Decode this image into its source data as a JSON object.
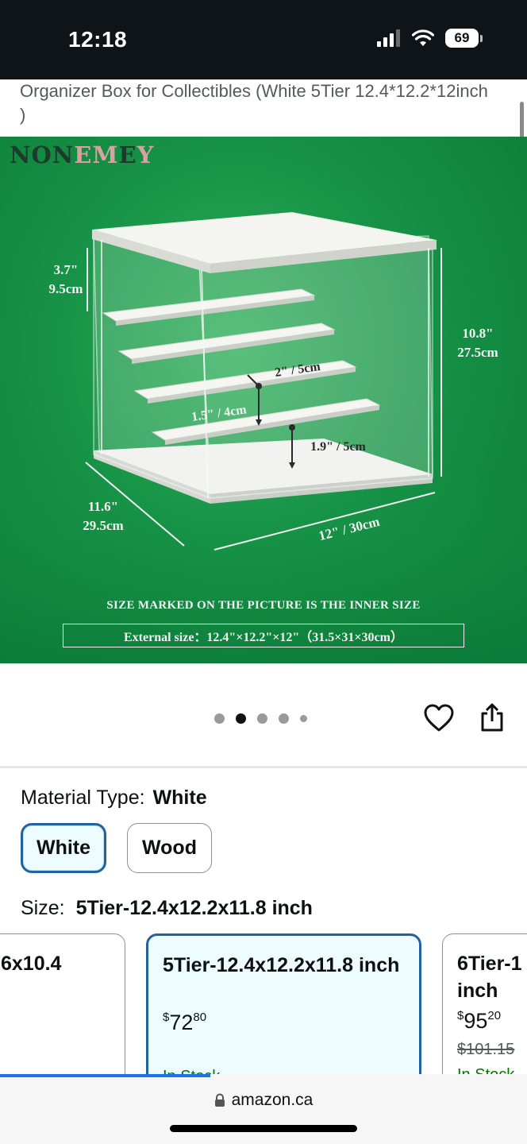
{
  "status": {
    "time": "12:18",
    "battery": "69"
  },
  "product": {
    "title": "Organizer Box for Collectibles (White 5Tier 12.4*12.2*12inch )"
  },
  "hero": {
    "brand_part1": "NON",
    "brand_part2": "EM",
    "brand_part3": "E",
    "brand_part4": "Y",
    "dim_top_a": "3.7\"",
    "dim_top_b": "9.5cm",
    "dim_right_a": "10.8\"",
    "dim_right_b": "27.5cm",
    "dim_step": "2\" / 5cm",
    "dim_depth_step": "1.5\" / 4cm",
    "dim_gap": "1.9\" / 5cm",
    "dim_left_a": "11.6\"",
    "dim_left_b": "29.5cm",
    "dim_bottom": "12\" / 30cm",
    "note_inner": "SIZE MARKED ON THE PICTURE IS THE INNER SIZE",
    "note_external": "External size：12.4\"×12.2\"×12\"（31.5×31×30cm）",
    "accent_color": "#169246"
  },
  "gallery": {
    "total": 5,
    "active_index": 1
  },
  "material": {
    "label": "Material Type:",
    "selected": "White",
    "options": [
      "White",
      "Wood"
    ]
  },
  "size": {
    "label": "Size:",
    "selected": "5Tier-12.4x12.2x11.8 inch",
    "cards": [
      {
        "name": "6x10.4",
        "price_whole": "",
        "price_cents": "",
        "list_price": "",
        "stock": ""
      },
      {
        "name": "5Tier-12.4x12.2x11.8 inch",
        "price_symbol": "$",
        "price_whole": "72",
        "price_cents": "80",
        "list_price": "",
        "stock": "In Stock"
      },
      {
        "name": "6Tier-1 inch",
        "price_symbol": "$",
        "price_whole": "95",
        "price_cents": "20",
        "list_price": "$101.15",
        "stock": "In Stock"
      }
    ]
  },
  "browser": {
    "url": "amazon.ca"
  },
  "icons": {
    "wishlist": "heart-icon",
    "share": "share-icon",
    "lock": "lock-icon",
    "wifi": "wifi-icon",
    "signal": "signal-icon"
  }
}
